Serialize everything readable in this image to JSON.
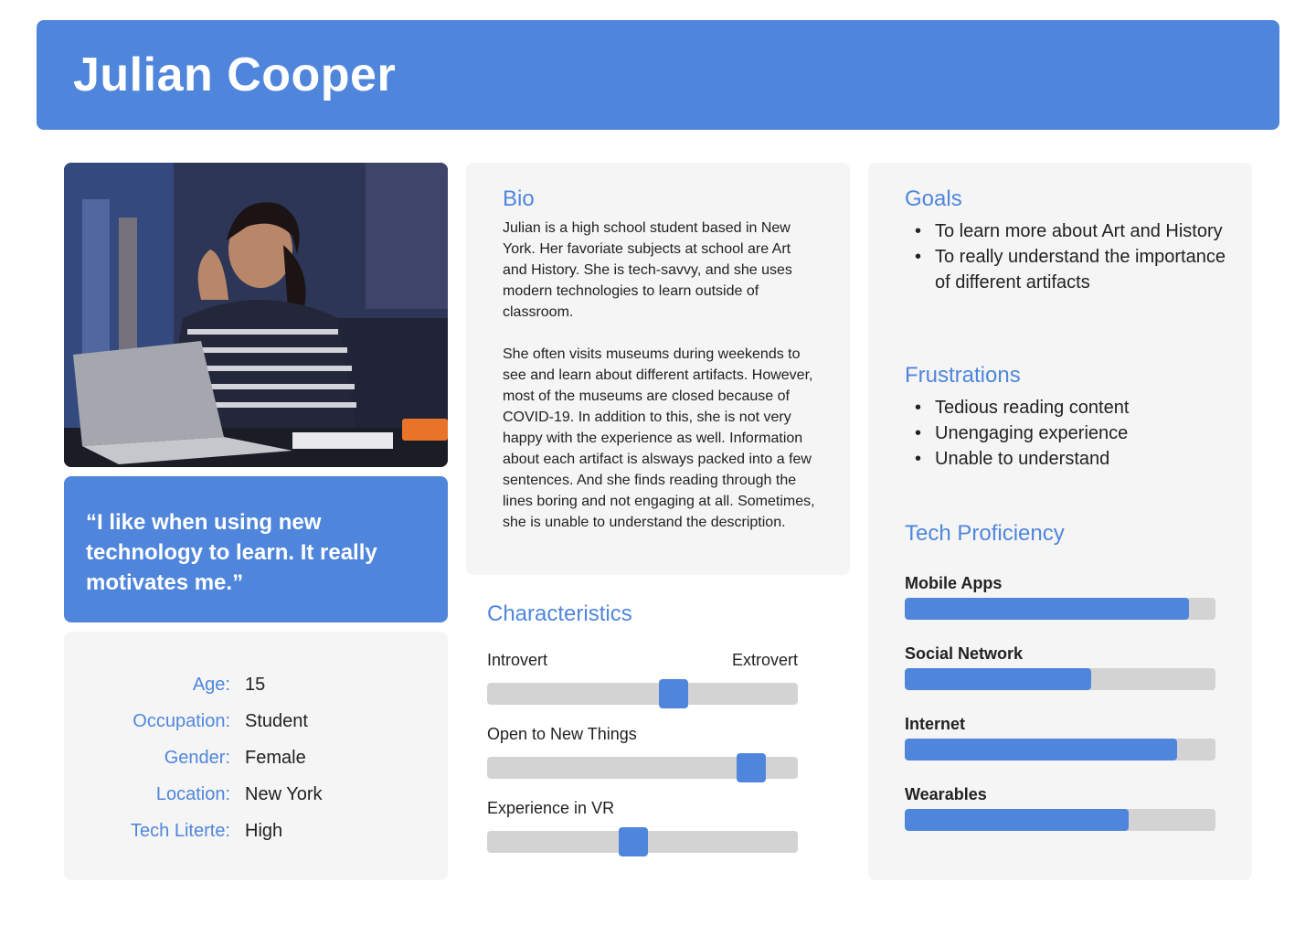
{
  "header": {
    "name": "Julian Cooper"
  },
  "quote": "“I like when using new technology to learn. It really motivates me.”",
  "demographics": [
    {
      "label": "Age:",
      "value": "15"
    },
    {
      "label": "Occupation:",
      "value": "Student"
    },
    {
      "label": "Gender:",
      "value": "Female"
    },
    {
      "label": "Location:",
      "value": "New York"
    },
    {
      "label": "Tech Literte:",
      "value": "High"
    }
  ],
  "bio": {
    "title": "Bio",
    "paragraphs": [
      "Julian is a high school student based in New York. Her favoriate subjects at school are Art and History. She is tech-savvy, and she uses modern technologies to learn outside of classroom.",
      "She often visits museums during weekends to see and learn about different artifacts. However,  most of the museums are closed because of COVID-19. In addition to this, she is not very happy with the experience as well. Information about each artifact is alsways packed into a few sentences. And she finds reading through the lines boring and not engaging at all. Sometimes, she is unable to understand the description."
    ]
  },
  "characteristics": {
    "title": "Characteristics",
    "sliders": [
      {
        "left_label": "Introvert",
        "right_label": "Extrovert",
        "level": 0.6
      },
      {
        "left_label": "Open to New Things",
        "right_label": "",
        "level": 0.85
      },
      {
        "left_label": "Experience in VR",
        "right_label": "",
        "level": 0.47
      }
    ]
  },
  "goals": {
    "title": "Goals",
    "items": [
      "To learn more about Art and History",
      "To really understand the importance of different artifacts"
    ]
  },
  "frustrations": {
    "title": "Frustrations",
    "items": [
      "Tedious reading content",
      "Unengaging experience",
      "Unable to understand"
    ]
  },
  "tech_proficiency": {
    "title": "Tech Proficiency",
    "items": [
      {
        "label": "Mobile Apps",
        "level": 0.915
      },
      {
        "label": "Social Network",
        "level": 0.6
      },
      {
        "label": "Internet",
        "level": 0.875
      },
      {
        "label": "Wearables",
        "level": 0.72
      }
    ]
  },
  "colors": {
    "accent": "#4f86dc",
    "panel": "#f5f5f5",
    "track": "#d3d3d3"
  }
}
